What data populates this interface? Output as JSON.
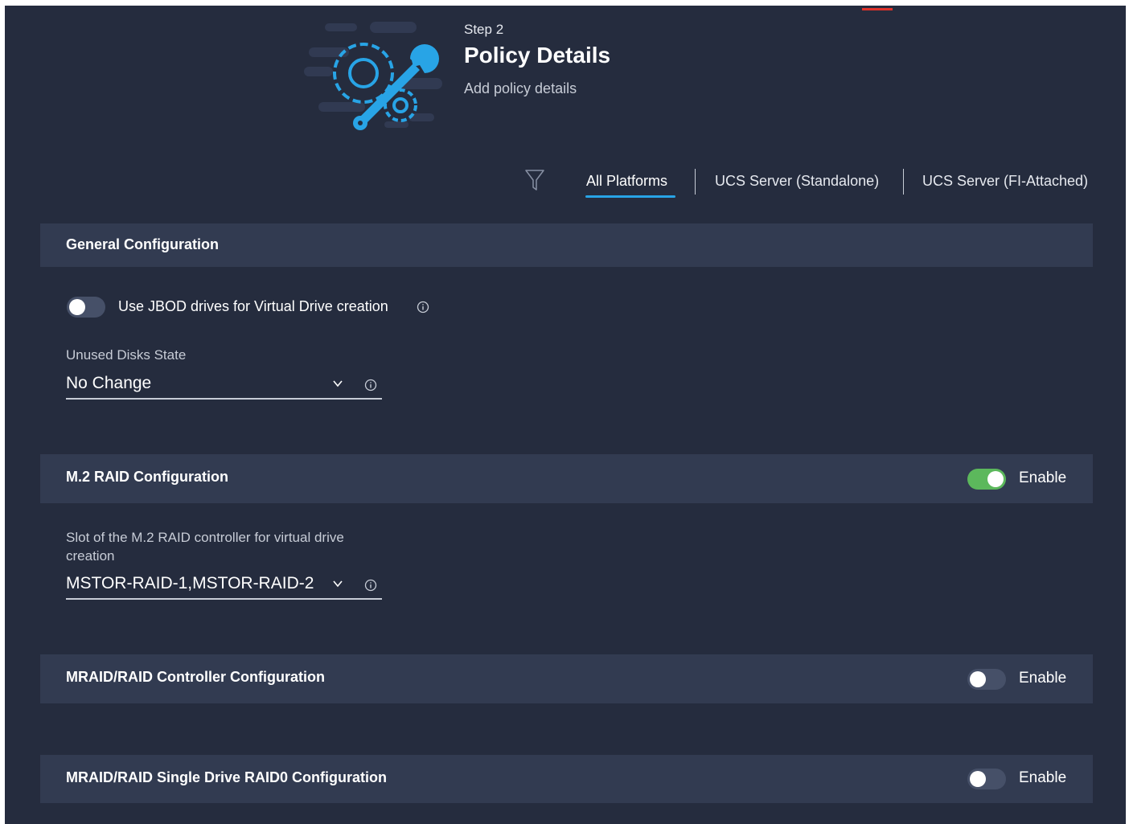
{
  "colors": {
    "page_bg": "#252c3e",
    "section_bg": "#323b51",
    "accent_blue": "#28a4e6",
    "toggle_on": "#5cb85c",
    "toggle_off": "#465068",
    "top_accent": "#e0322a"
  },
  "header": {
    "icon": "gear-wrench-icon",
    "step": "Step 2",
    "title": "Policy Details",
    "subtitle": "Add policy details"
  },
  "platform_filter": {
    "icon": "filter-icon",
    "tabs": [
      {
        "label": "All Platforms",
        "active": true
      },
      {
        "label": "UCS Server (Standalone)",
        "active": false
      },
      {
        "label": "UCS Server (FI-Attached)",
        "active": false
      }
    ]
  },
  "general_configuration": {
    "title": "General Configuration",
    "jbod_toggle": {
      "label": "Use JBOD drives for Virtual Drive creation",
      "on": false
    },
    "unused_disks": {
      "label": "Unused Disks State",
      "value": "No Change"
    }
  },
  "m2_raid": {
    "title": "M.2 RAID Configuration",
    "enable_label": "Enable",
    "enabled": true,
    "slot_field": {
      "label_line1": "Slot of the M.2 RAID controller for virtual drive",
      "label_line2": "creation",
      "value": "MSTOR-RAID-1,MSTOR-RAID-2"
    }
  },
  "mraid_controller": {
    "title": "MRAID/RAID Controller Configuration",
    "enable_label": "Enable",
    "enabled": false
  },
  "mraid_single_drive": {
    "title": "MRAID/RAID Single Drive RAID0 Configuration",
    "enable_label": "Enable",
    "enabled": false
  }
}
